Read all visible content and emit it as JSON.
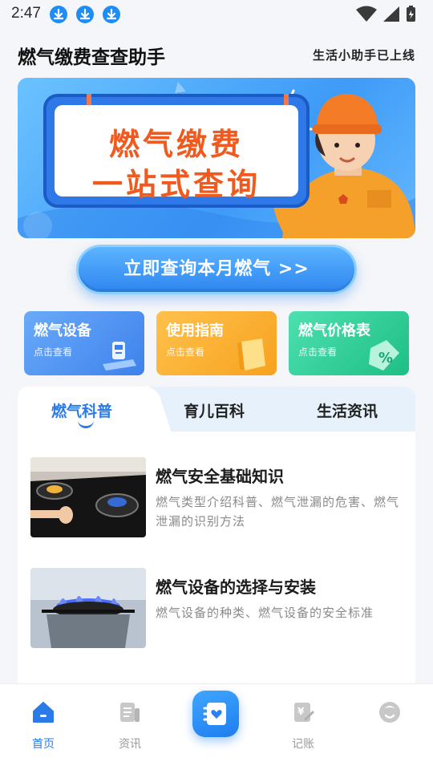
{
  "status_bar": {
    "time": "2:47",
    "icons": [
      "download-icon",
      "download-icon",
      "download-icon",
      "wifi-icon",
      "signal-icon",
      "battery-icon"
    ]
  },
  "header": {
    "title": "燃气缴费查查助手",
    "slogan": "生活小助手已上线"
  },
  "banner": {
    "line1": "燃气缴费",
    "line2": "一站式查询"
  },
  "cta": {
    "label": "立即查询本月燃气 >>"
  },
  "quick_cards": [
    {
      "title": "燃气设备",
      "subtitle": "点击查看",
      "icon": "gas-meter-icon",
      "color": "#4a8ff2"
    },
    {
      "title": "使用指南",
      "subtitle": "点击查看",
      "icon": "book-icon",
      "color": "#f9ad2e"
    },
    {
      "title": "燃气价格表",
      "subtitle": "点击查看",
      "icon": "price-tag-icon",
      "color": "#2bcb93"
    }
  ],
  "tabs": [
    {
      "label": "燃气科普",
      "active": true
    },
    {
      "label": "育儿百科",
      "active": false
    },
    {
      "label": "生活资讯",
      "active": false
    }
  ],
  "articles": [
    {
      "title": "燃气安全基础知识",
      "description": "燃气类型介绍科普、燃气泄漏的危害、燃气泄漏的识别方法"
    },
    {
      "title": "燃气设备的选择与安装",
      "description": " 燃气设备的种类、燃气设备的安全标准"
    }
  ],
  "bottom_nav": {
    "items": [
      {
        "label": "首页",
        "icon": "home-icon",
        "active": true
      },
      {
        "label": "资讯",
        "icon": "news-icon",
        "active": false
      },
      {
        "label": "",
        "icon": "heart-book-icon",
        "active": false
      },
      {
        "label": "记账",
        "icon": "bill-icon",
        "active": false
      },
      {
        "label": "",
        "icon": "profile-icon",
        "active": false
      }
    ]
  },
  "colors": {
    "accent": "#2a7be8",
    "banner_text": "#f05a1e"
  }
}
